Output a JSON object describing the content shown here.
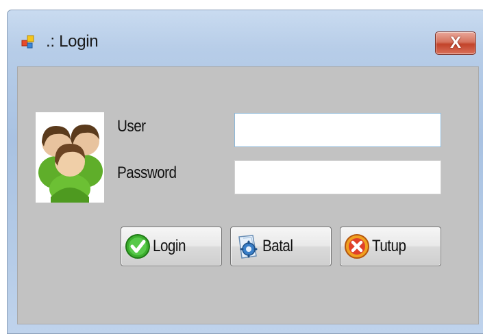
{
  "window": {
    "title": ".: Login",
    "close_label": "X"
  },
  "form": {
    "user_label": "User",
    "password_label": "Password",
    "user_value": "",
    "password_value": ""
  },
  "buttons": {
    "login": {
      "label": "Login",
      "icon": "check-circle-icon"
    },
    "batal": {
      "label": "Batal",
      "icon": "gear-document-icon"
    },
    "tutup": {
      "label": "Tutup",
      "icon": "cancel-circle-icon"
    }
  },
  "colors": {
    "title_bar": "#b7cde8",
    "client_bg": "#c2c2c2",
    "close_button": "#c2432a"
  }
}
